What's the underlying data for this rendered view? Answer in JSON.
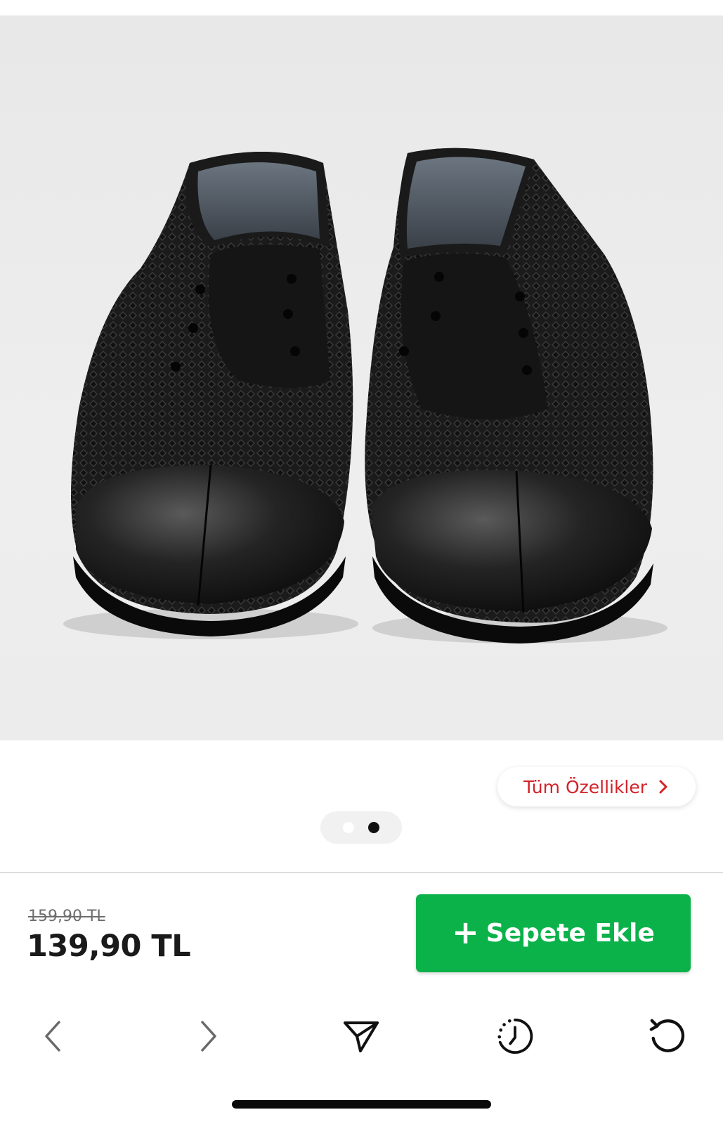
{
  "product": {
    "all_features_label": "Tüm Özellikler",
    "image_count": 2,
    "active_image_index": 2
  },
  "pricing": {
    "old_price": "159,90 TL",
    "price": "139,90 TL"
  },
  "cart": {
    "add_label": "Sepete Ekle"
  },
  "colors": {
    "accent_red": "#d2232a",
    "cart_green": "#0bb24a"
  },
  "browser": {
    "icons": [
      "chevron-left-icon",
      "chevron-right-icon",
      "send-icon",
      "history-icon",
      "reload-icon"
    ]
  }
}
